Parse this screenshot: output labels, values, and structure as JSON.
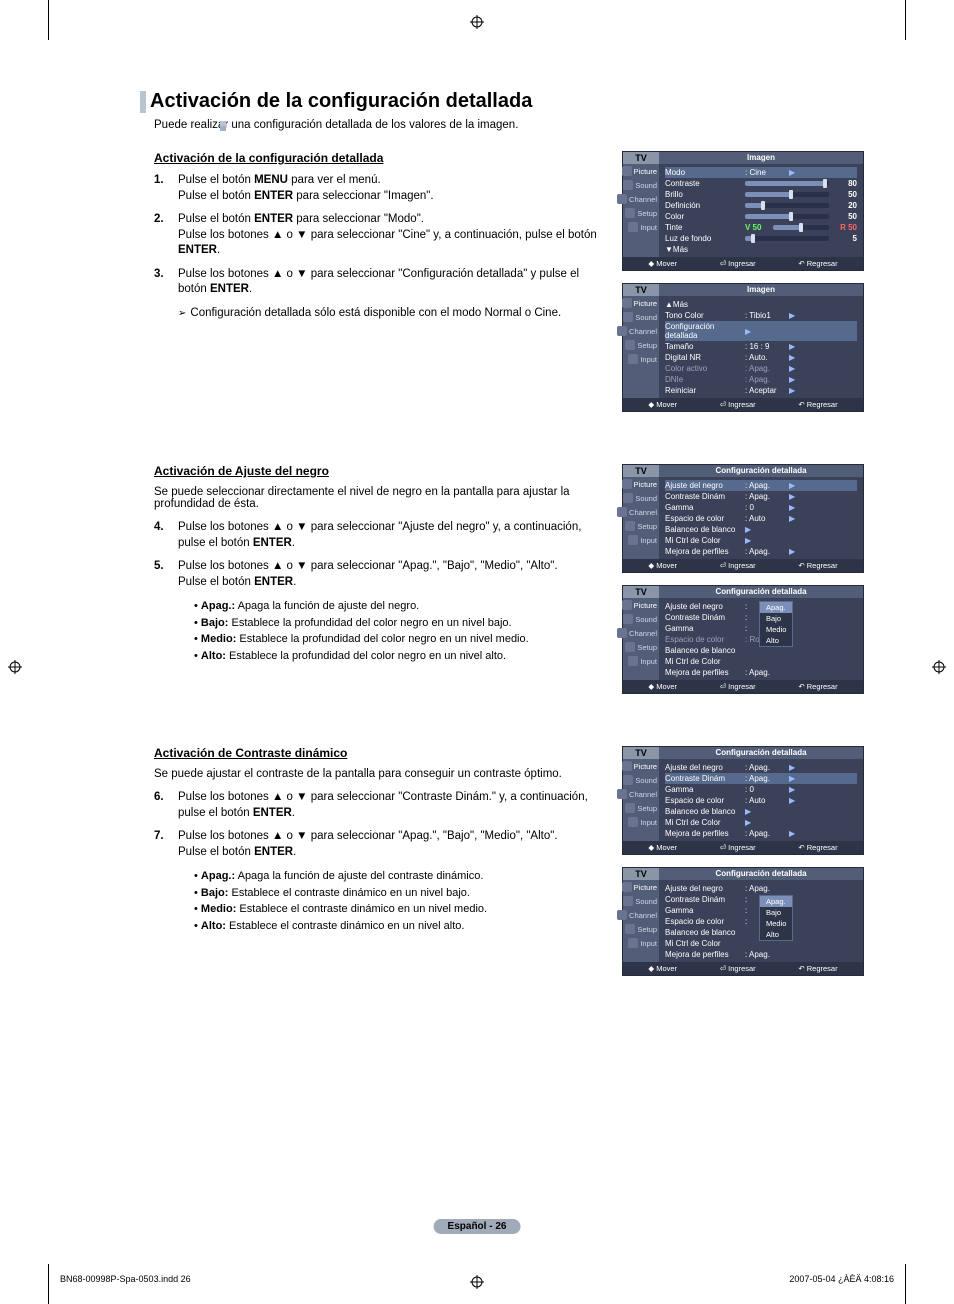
{
  "page": {
    "title": "Activación de la configuración detallada",
    "subtitle": "Puede realizar una configuración detallada de los valores de la imagen.",
    "pagenum": "Español - 26",
    "footer_left": "BN68-00998P-Spa-0503.indd   26",
    "footer_right": "2007-05-04   ¿ÀÈÄ 4:08:16"
  },
  "s1": {
    "heading": "Activación de la configuración detallada",
    "steps": [
      {
        "n": "1.",
        "txt": "Pulse el botón <b>MENU</b> para ver el menú.<br>Pulse el botón <b>ENTER</b> para seleccionar \"Imagen\"."
      },
      {
        "n": "2.",
        "txt": "Pulse el botón <b>ENTER</b> para seleccionar \"Modo\".<br>Pulse los botones ▲ o ▼ para seleccionar \"Cine\" y, a continuación, pulse el botón <b>ENTER</b>."
      },
      {
        "n": "3.",
        "txt": "Pulse los botones ▲ o ▼ para seleccionar \"Configuración detallada\" y pulse el botón <b>ENTER</b>."
      }
    ],
    "note": "Configuración detallada sólo está disponible con el modo Normal o Cine."
  },
  "s2": {
    "heading": "Activación de Ajuste del negro",
    "intro": "Se puede seleccionar directamente el nivel de negro en la pantalla para ajustar la profundidad de ésta.",
    "steps": [
      {
        "n": "4.",
        "txt": "Pulse los botones ▲ o ▼ para seleccionar \"Ajuste del negro\" y, a continuación, pulse el botón <b>ENTER</b>."
      },
      {
        "n": "5.",
        "txt": "Pulse los botones ▲ o ▼ para seleccionar \"Apag.\", \"Bajo\", \"Medio\", \"Alto\".<br>Pulse el botón <b>ENTER</b>."
      }
    ],
    "defs": [
      {
        "k": "Apag.:",
        "v": " Apaga la función de ajuste del negro."
      },
      {
        "k": "Bajo:",
        "v": " Establece la profundidad del color negro en un nivel bajo."
      },
      {
        "k": "Medio:",
        "v": " Establece la profundidad del color negro en un nivel medio."
      },
      {
        "k": "Alto:",
        "v": " Establece la profundidad del color negro en un nivel alto."
      }
    ]
  },
  "s3": {
    "heading": "Activación de Contraste dinámico",
    "intro": "Se puede ajustar el contraste de la pantalla para conseguir un contraste óptimo.",
    "steps": [
      {
        "n": "6.",
        "txt": "Pulse los botones ▲ o ▼ para seleccionar \"Contraste Dinám.\" y, a continuación, pulse el botón <b>ENTER</b>."
      },
      {
        "n": "7.",
        "txt": "Pulse los botones ▲ o ▼ para seleccionar \"Apag.\", \"Bajo\", \"Medio\", \"Alto\".<br>Pulse el botón <b>ENTER</b>."
      }
    ],
    "defs": [
      {
        "k": "Apag.:",
        "v": " Apaga la función de ajuste del contraste dinámico."
      },
      {
        "k": "Bajo:",
        "v": " Establece el contraste dinámico en un nivel bajo."
      },
      {
        "k": "Medio:",
        "v": " Establece el contraste dinámico en un nivel medio."
      },
      {
        "k": "Alto:",
        "v": " Establece el contraste dinámico en un nivel alto."
      }
    ]
  },
  "osd": {
    "tv": "TV",
    "side": [
      "Picture",
      "Sound",
      "Channel",
      "Setup",
      "Input"
    ],
    "ftr": {
      "move": "Mover",
      "enter": "Ingresar",
      "return": "Regresar"
    },
    "img1": {
      "title": "Imagen",
      "rows": [
        {
          "lbl": "Modo",
          "val": ": Cine",
          "hi": true,
          "arw": true
        },
        {
          "lbl": "Contraste",
          "slider": 95,
          "num": "80"
        },
        {
          "lbl": "Brillo",
          "slider": 55,
          "num": "50"
        },
        {
          "lbl": "Definición",
          "slider": 22,
          "num": "20"
        },
        {
          "lbl": "Color",
          "slider": 55,
          "num": "50"
        },
        {
          "lbl": "Tinte",
          "lv": "V 50",
          "slider": 50,
          "num": "R 50",
          "green": true
        },
        {
          "lbl": "Luz de fondo",
          "slider": 10,
          "num": "5"
        },
        {
          "lbl": "▼Más"
        }
      ]
    },
    "img2": {
      "title": "Imagen",
      "rows": [
        {
          "lbl": "▲Más"
        },
        {
          "lbl": "Tono Color",
          "val": ": Tibio1",
          "arw": true
        },
        {
          "lbl": "Configuración detallada",
          "hi": true,
          "arw": true
        },
        {
          "lbl": "Tamaño",
          "val": ": 16 : 9",
          "arw": true
        },
        {
          "lbl": "Digital NR",
          "val": ": Auto.",
          "arw": true
        },
        {
          "lbl": "Color activo",
          "val": ": Apag.",
          "dim": true,
          "arw": true
        },
        {
          "lbl": "DNIe",
          "val": ": Apag.",
          "dim": true,
          "arw": true
        },
        {
          "lbl": "Reiniciar",
          "val": ": Aceptar",
          "arw": true
        }
      ]
    },
    "cd1": {
      "title": "Configuración detallada",
      "rows": [
        {
          "lbl": "Ajuste del negro",
          "val": ": Apag.",
          "hi": true,
          "arw": true
        },
        {
          "lbl": "Contraste Dinám",
          "val": ": Apag.",
          "arw": true
        },
        {
          "lbl": "Gamma",
          "val": ": 0",
          "arw": true
        },
        {
          "lbl": "Espacio de color",
          "val": ": Auto",
          "arw": true
        },
        {
          "lbl": "Balanceo de blanco",
          "arw": true
        },
        {
          "lbl": "Mi Ctrl de Color",
          "arw": true
        },
        {
          "lbl": "Mejora de perfiles",
          "val": ": Apag.",
          "arw": true
        }
      ]
    },
    "cd2": {
      "title": "Configuración detallada",
      "rows": [
        {
          "lbl": "Ajuste del negro",
          "val": ":",
          "popup": [
            "Apag.",
            "Bajo",
            "Medio",
            "Alto"
          ],
          "popupSel": 0
        },
        {
          "lbl": "Contraste Dinám",
          "val": ":"
        },
        {
          "lbl": "Gamma",
          "val": ":"
        },
        {
          "lbl": "Espacio de color",
          "val": ": Rojo",
          "dim": true
        },
        {
          "lbl": "Balanceo de blanco"
        },
        {
          "lbl": "Mi Ctrl de Color"
        },
        {
          "lbl": "Mejora de perfiles",
          "val": ": Apag."
        }
      ]
    },
    "cd3": {
      "title": "Configuración detallada",
      "rows": [
        {
          "lbl": "Ajuste del negro",
          "val": ": Apag.",
          "arw": true
        },
        {
          "lbl": "Contraste Dinám",
          "val": ": Apag.",
          "hi": true,
          "arw": true
        },
        {
          "lbl": "Gamma",
          "val": ": 0",
          "arw": true
        },
        {
          "lbl": "Espacio de color",
          "val": ": Auto",
          "arw": true
        },
        {
          "lbl": "Balanceo de blanco",
          "arw": true
        },
        {
          "lbl": "Mi Ctrl de Color",
          "arw": true
        },
        {
          "lbl": "Mejora de perfiles",
          "val": ": Apag.",
          "arw": true
        }
      ]
    },
    "cd4": {
      "title": "Configuración detallada",
      "rows": [
        {
          "lbl": "Ajuste del negro",
          "val": ": Apag."
        },
        {
          "lbl": "Contraste Dinám",
          "val": ":",
          "popup": [
            "Apag.",
            "Bajo",
            "Medio",
            "Alto"
          ],
          "popupSel": 0
        },
        {
          "lbl": "Gamma",
          "val": ":"
        },
        {
          "lbl": "Espacio de color",
          "val": ":"
        },
        {
          "lbl": "Balanceo de blanco"
        },
        {
          "lbl": "Mi Ctrl de Color"
        },
        {
          "lbl": "Mejora de perfiles",
          "val": ": Apag."
        }
      ]
    }
  }
}
